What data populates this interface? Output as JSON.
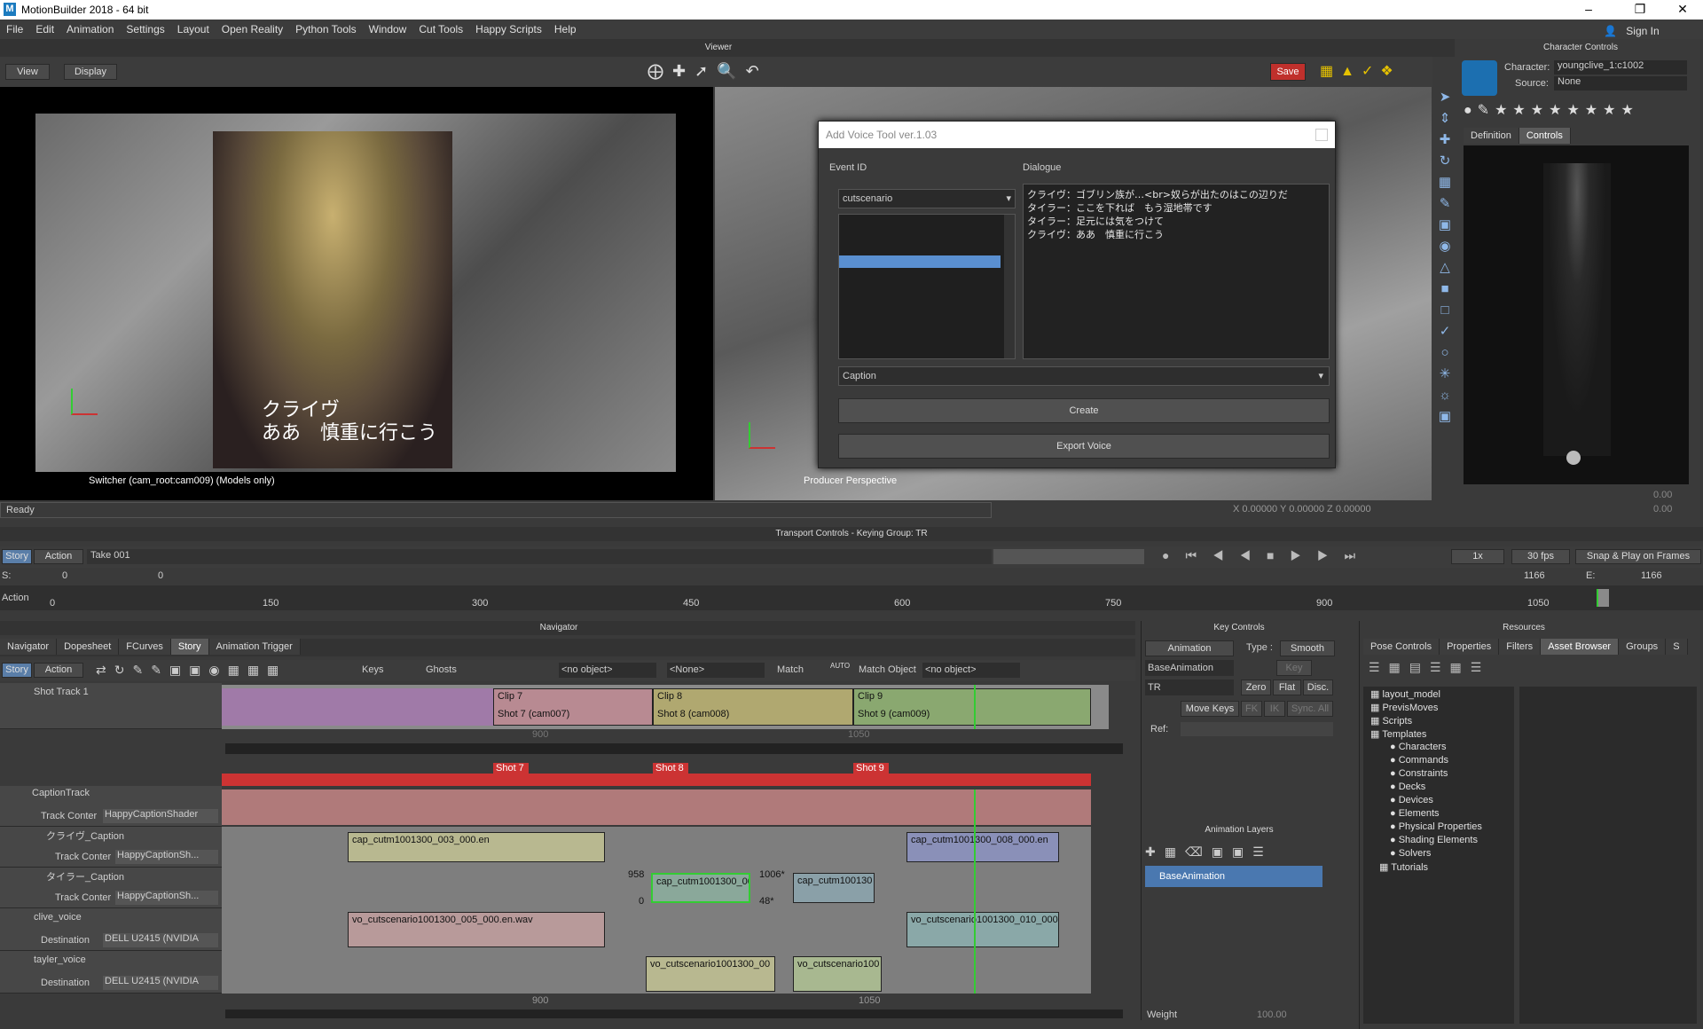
{
  "app": {
    "title": "MotionBuilder 2018 - 64 bit",
    "sign_in": "Sign In",
    "status": "Ready"
  },
  "menu": [
    "File",
    "Edit",
    "Animation",
    "Settings",
    "Layout",
    "Open Reality",
    "Python Tools",
    "Window",
    "Cut Tools",
    "Happy Scripts",
    "Help"
  ],
  "viewer": {
    "title": "Viewer",
    "view_btn": "View",
    "display_btn": "Display",
    "save_btn": "Save",
    "left_caption": "Switcher (cam_root:cam009) (Models only)",
    "right_caption": "Producer Perspective",
    "subtitle_line1": "クライヴ",
    "subtitle_line2": "ああ　慎重に行こう",
    "coord_x": "0.00000",
    "coord_y": "0.00000",
    "coord_z": "0.00000"
  },
  "voice_tool": {
    "title": "Add Voice Tool ver.1.03",
    "event_id_label": "Event ID",
    "dialogue_label": "Dialogue",
    "event_select": "cutscenario",
    "dialogue_lines": [
      "クライヴ：ゴブリン族が…<br>奴らが出たのはこの辺りだ",
      "タイラー：ここを下れば　もう湿地帯です",
      "タイラー：足元には気をつけて",
      "クライヴ：ああ　慎重に行こう"
    ],
    "caption_select": "Caption",
    "create_btn": "Create",
    "export_btn": "Export Voice"
  },
  "character_controls": {
    "title": "Character Controls",
    "character_label": "Character:",
    "character_value": "youngclive_1:c1002",
    "source_label": "Source:",
    "source_value": "None",
    "tabs": [
      "Definition",
      "Controls"
    ],
    "val1": "0.00",
    "val2": "0.00"
  },
  "transport": {
    "title": "Transport Controls  -  Keying Group: TR",
    "mode_story": "Story",
    "mode_action": "Action",
    "take": "Take 001",
    "start_label": "S:",
    "start_val": "0",
    "cursor_val": "0",
    "end_label": "E:",
    "end_val": "1166",
    "end_val2": "1166",
    "speed": "1x",
    "fps": "30 fps",
    "snap": "Snap & Play on Frames",
    "ruler_label": "Action",
    "ruler_ticks": [
      "0",
      "150",
      "300",
      "450",
      "600",
      "750",
      "900",
      "1050"
    ]
  },
  "navigator": {
    "title": "Navigator",
    "tabs": [
      "Navigator",
      "Dopesheet",
      "FCurves",
      "Story",
      "Animation Trigger"
    ],
    "active_tab": "Story",
    "mode_story": "Story",
    "mode_action": "Action",
    "keys_label": "Keys",
    "ghosts_label": "Ghosts",
    "obj_select": "<no object>",
    "none_select": "<None>",
    "match_label": "Match",
    "auto_label": "AUTO",
    "match_object_label": "Match Object",
    "match_object_select": "<no object>",
    "shot_track": "Shot Track 1",
    "clips": [
      {
        "name": "Clip 7",
        "shot": "Shot 7 (cam007)"
      },
      {
        "name": "Clip 8",
        "shot": "Shot 8 (cam008)"
      },
      {
        "name": "Clip 9",
        "shot": "Shot 9 (cam009)"
      }
    ],
    "ruler1": [
      "900",
      "1050"
    ],
    "shots": [
      "Shot 7",
      "Shot 8",
      "Shot 9"
    ],
    "tracks": [
      {
        "name": "CaptionTrack",
        "sub_label": "Track Conter",
        "sub_value": "HappyCaptionShader"
      },
      {
        "name": "クライヴ_Caption",
        "sub_label": "Track Conter",
        "sub_value": "HappyCaptionSh..."
      },
      {
        "name": "タイラー_Caption",
        "sub_label": "Track Conter",
        "sub_value": "HappyCaptionSh..."
      },
      {
        "name": "clive_voice",
        "sub_label": "Destination",
        "sub_value": "DELL U2415 (NVIDIA"
      },
      {
        "name": "tayler_voice",
        "sub_label": "Destination",
        "sub_value": "DELL U2415 (NVIDIA"
      }
    ],
    "story_clips": {
      "c1": "cap_cutm1001300_003_000.en",
      "c2": "cap_cutm1001300_008_000.en",
      "c3": "cap_cutm1001300_00",
      "c4": "cap_cutm100130",
      "v1": "vo_cutscenario1001300_005_000.en.wav",
      "v2": "vo_cutscenario1001300_010_000",
      "v3": "vo_cutscenario1001300_00",
      "v4": "vo_cutscenario100"
    },
    "clip_marks": {
      "left_top": "958",
      "left_bot": "0",
      "right_top": "1006*",
      "right_bot": "48*"
    },
    "ruler2": [
      "900",
      "1050"
    ]
  },
  "key_controls": {
    "title": "Key Controls",
    "animation_btn": "Animation",
    "type_label": "Type :",
    "type_value": "Smooth",
    "layer_select": "BaseAnimation",
    "key_btn": "Key",
    "tr_select": "TR",
    "zero_btn": "Zero",
    "flat_btn": "Flat",
    "disc_btn": "Disc.",
    "move_keys_btn": "Move Keys",
    "fk_btn": "FK",
    "ik_btn": "IK",
    "sync_btn": "Sync. All",
    "ref_label": "Ref:",
    "anim_layers_title": "Animation Layers",
    "base_layer": "BaseAnimation",
    "weight_label": "Weight",
    "weight_value": "100.00"
  },
  "resources": {
    "title": "Resources",
    "tabs": [
      "Pose Controls",
      "Properties",
      "Filters",
      "Asset Browser",
      "Groups",
      "S"
    ],
    "active_tab": "Asset Browser",
    "tree": [
      "layout_model",
      "PrevisMoves",
      "Scripts",
      "Templates",
      "Characters",
      "Commands",
      "Constraints",
      "Decks",
      "Devices",
      "Elements",
      "Physical Properties",
      "Shading Elements",
      "Solvers",
      "Tutorials"
    ]
  },
  "colors": {
    "accent": "#5a8fd0",
    "save": "#c0302c",
    "shot_bar": "#cc3333"
  }
}
